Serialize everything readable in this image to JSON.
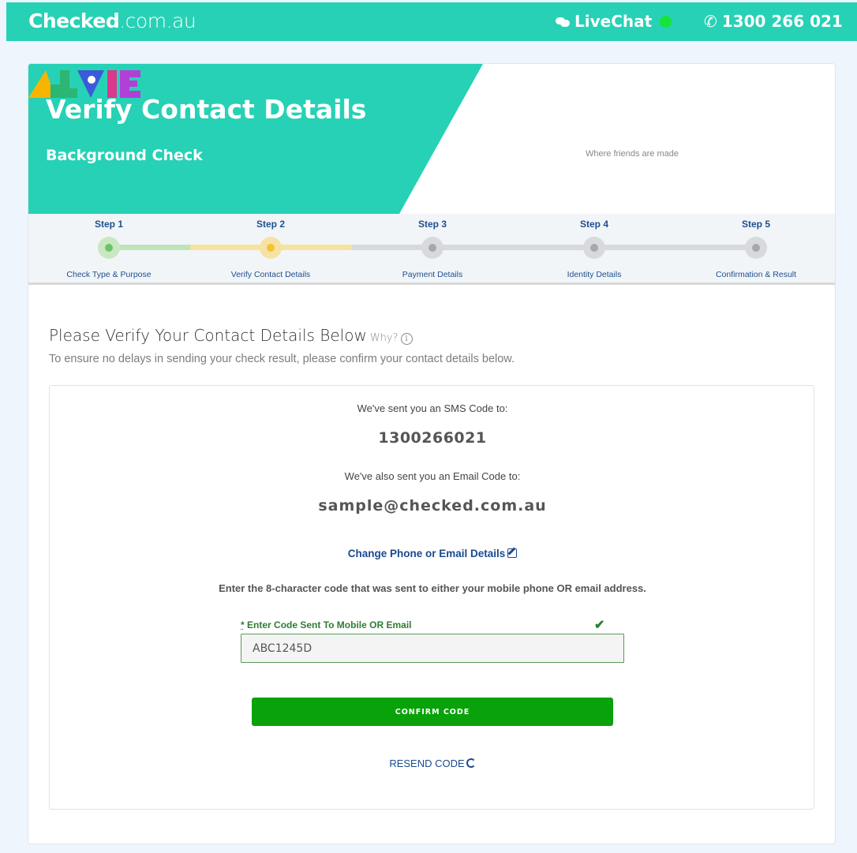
{
  "header": {
    "logo_bold": "Checked",
    "logo_light": ".com.au",
    "livechat_label": "LiveChat",
    "phone_label": "1300 266 021"
  },
  "banner": {
    "title": "Verify Contact Details",
    "subtitle": "Background Check",
    "partner_tagline": "Where friends are made",
    "partner_brand": "ALVIE",
    "color": "#27d1b5"
  },
  "steps": [
    {
      "label": "Step 1",
      "name": "Check Type & Purpose",
      "status": "complete"
    },
    {
      "label": "Step 2",
      "name": "Verify Contact Details",
      "status": "current"
    },
    {
      "label": "Step 3",
      "name": "Payment Details",
      "status": "pending"
    },
    {
      "label": "Step 4",
      "name": "Identity Details",
      "status": "pending"
    },
    {
      "label": "Step 5",
      "name": "Confirmation & Result",
      "status": "pending"
    }
  ],
  "main": {
    "heading": "Please Verify Your Contact Details Below",
    "why_label": "Why?",
    "info_icon": "i",
    "subheading": "To ensure no delays in sending your check result, please confirm your contact details below.",
    "sms_sent_label": "We've sent you an SMS Code to:",
    "phone_number": "1300266021",
    "email_sent_label": "We've also sent you an Email Code to:",
    "email": "sample@checked.com.au",
    "change_link": "Change Phone or Email Details",
    "instruction": "Enter the 8-character code that was sent to either your mobile phone OR email address.",
    "code_required_mark": "*",
    "code_label": "Enter Code Sent To Mobile OR Email",
    "code_value": "ABC1245D",
    "confirm_button": "CONFIRM CODE",
    "resend_link": "RESEND CODE"
  },
  "colors": {
    "brand_teal": "#27d1b5",
    "success_green": "#0aa20a",
    "link_blue": "#1a4a8f",
    "step_complete": "#a8dca0",
    "step_current": "#f5d77a"
  }
}
